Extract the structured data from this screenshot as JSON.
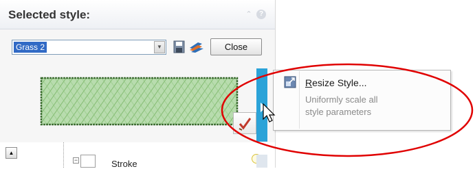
{
  "panel": {
    "title": "Selected style:",
    "style_select": {
      "value": "Grass 2"
    },
    "close_label": "Close",
    "icons": {
      "collapse": "chevron-up-icon",
      "help": "help-icon",
      "save": "save-icon",
      "brush": "brush-icon"
    }
  },
  "tree": {
    "item_label": "Stroke"
  },
  "context_menu": {
    "item_label": "Resize Style...",
    "item_mnemonic": "R",
    "item_description": "Uniformly scale all style parameters"
  },
  "colors": {
    "accent_blue": "#2ba3d8",
    "selection_blue": "#316ac5",
    "highlight_red": "#e00000",
    "grass_green": "#9ccf8e"
  }
}
